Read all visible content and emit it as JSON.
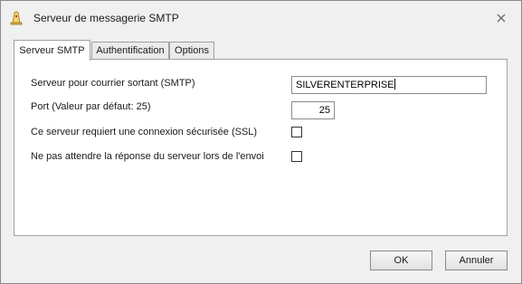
{
  "window": {
    "title": "Serveur de messagerie SMTP"
  },
  "tabs": [
    {
      "label": "Serveur SMTP",
      "active": true
    },
    {
      "label": "Authentification",
      "active": false
    },
    {
      "label": "Options",
      "active": false
    }
  ],
  "form": {
    "smtp_server_label": "Serveur pour courrier sortant (SMTP)",
    "smtp_server_value": "SILVERENTERPRISE",
    "port_label": "Port (Valeur par défaut: 25)",
    "port_value": "25",
    "ssl_label": "Ce serveur requiert une connexion sécurisée (SSL)",
    "ssl_checked": false,
    "no_wait_label": "Ne pas attendre la réponse du serveur lors de l'envoi",
    "no_wait_checked": false
  },
  "buttons": {
    "ok_label": "OK",
    "cancel_label": "Annuler"
  },
  "icons": {
    "app": "wizard-hat-icon",
    "close": "close-icon"
  }
}
